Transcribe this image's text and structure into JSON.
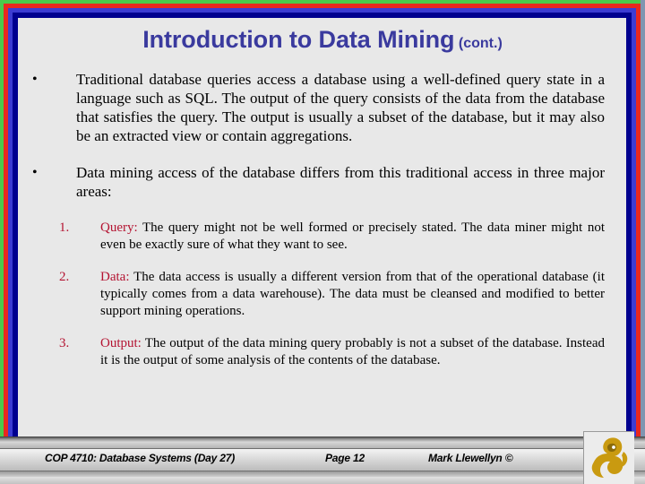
{
  "slide": {
    "title_main": "Introduction to Data Mining",
    "title_suffix": "(cont.)",
    "title_color": "#3a3a9e",
    "background_color": "#e8e8e8",
    "accent_color": "#b41432",
    "frame_colors": {
      "green": "#4ac94a",
      "red": "#e8281e",
      "blue": "#3c3cd2",
      "navy": "#00008f",
      "slate": "#8095b0"
    }
  },
  "bullets": [
    {
      "marker": "•",
      "text": "Traditional database queries access a database using a well-defined query state in a language such as SQL.  The output of the query consists of the data from the database that satisfies the query.  The output is usually a subset of the database, but it may also be an extracted view or contain aggregations."
    },
    {
      "marker": "•",
      "text": "Data mining access of the database differs from this traditional access in three major areas:"
    }
  ],
  "numbered_items": [
    {
      "number": "1.",
      "keyword": "Query",
      "separator": ":",
      "text": "  The query might not be well formed or precisely stated.  The data miner might not even be exactly sure of what they want to see."
    },
    {
      "number": "2.",
      "keyword": "Data",
      "separator": ":",
      "text": " The data access is usually a different version from that of the operational database (it typically comes from a data warehouse).  The data must be cleansed and modified to better support mining operations."
    },
    {
      "number": "3.",
      "keyword": "Output",
      "separator": ":",
      "text": "  The output of the data mining query probably is not a subset of the database.  Instead it is the output of some analysis of the contents of the database."
    }
  ],
  "footer": {
    "course": "COP 4710: Database Systems  (Day 27)",
    "page": "Page 12",
    "author": "Mark Llewellyn ©",
    "logo_color": "#c99a10"
  }
}
